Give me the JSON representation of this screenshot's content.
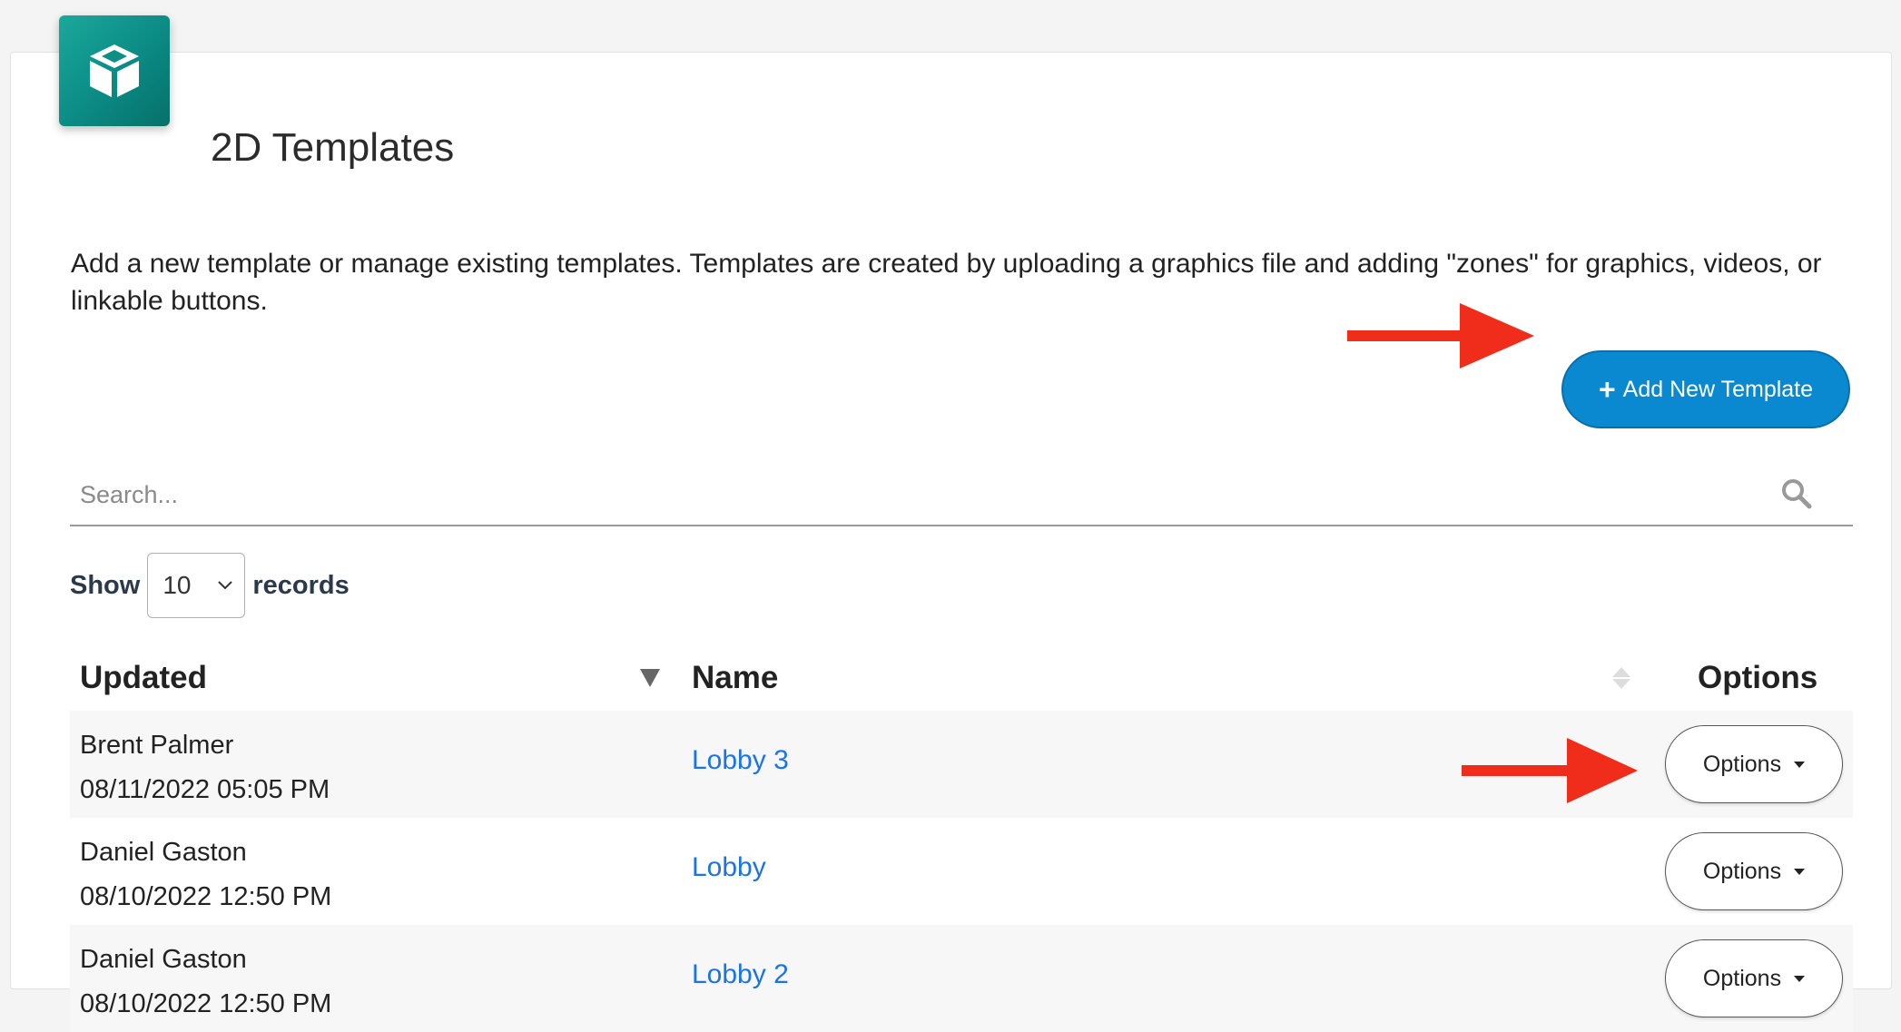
{
  "header": {
    "title": "2D Templates",
    "logo_icon": "cube-icon"
  },
  "description": "Add a new template or manage existing templates. Templates are created by uploading a graphics file and adding \"zones\" for graphics, videos, or linkable buttons.",
  "add_button": {
    "icon": "plus",
    "label": "Add New Template",
    "color": "#0a89d0"
  },
  "search": {
    "placeholder": "Search...",
    "icon": "search-icon"
  },
  "records": {
    "show_label": "Show",
    "selected": "10",
    "records_label": "records"
  },
  "table": {
    "columns": {
      "updated": "Updated",
      "name": "Name",
      "options": "Options"
    },
    "rows": [
      {
        "updated_by": "Brent Palmer",
        "updated_at": "08/11/2022 05:05 PM",
        "name": "Lobby 3",
        "options_label": "Options"
      },
      {
        "updated_by": "Daniel Gaston",
        "updated_at": "08/10/2022 12:50 PM",
        "name": "Lobby",
        "options_label": "Options"
      },
      {
        "updated_by": "Daniel Gaston",
        "updated_at": "08/10/2022 12:50 PM",
        "name": "Lobby 2",
        "options_label": "Options"
      }
    ]
  },
  "annotation_color": "#f02d1a",
  "link_color": "#1a73e8"
}
